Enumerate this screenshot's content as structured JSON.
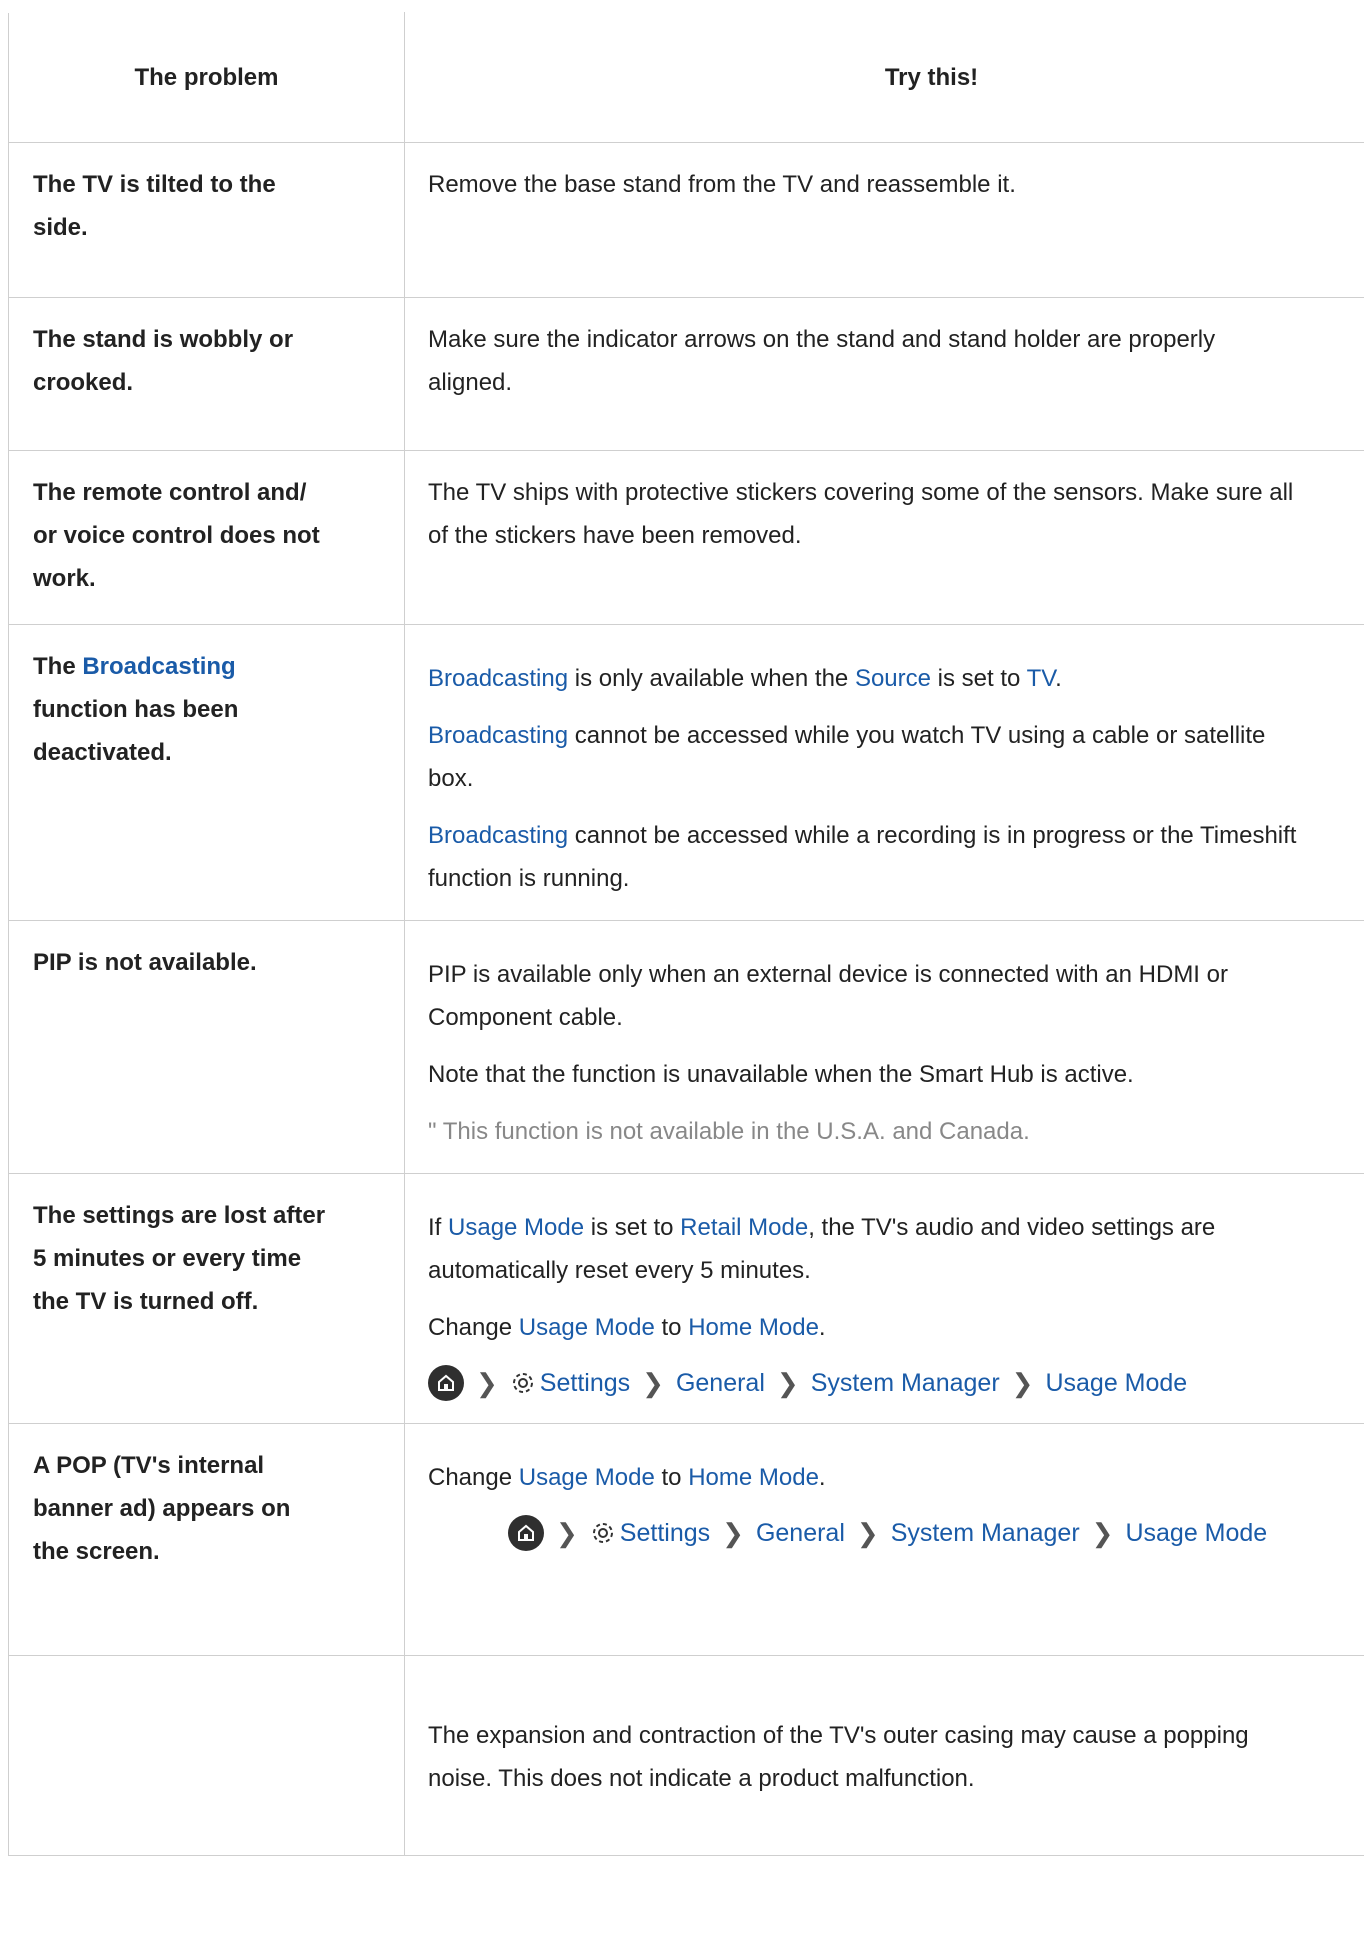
{
  "header": {
    "col1": "The problem",
    "col2": "Try this!"
  },
  "rows": [
    {
      "problem": "The TV is tilted to the side.",
      "problem_lines": [
        "The TV is tilted to the",
        "side."
      ],
      "solution_lines": [
        "Remove the base stand from the TV and reassemble it."
      ]
    },
    {
      "problem_lines": [
        "The stand is wobbly or",
        "crooked."
      ],
      "solution_lines": [
        "Make sure the indicator arrows on the stand and stand holder are properly",
        "aligned."
      ]
    },
    {
      "problem_lines": [
        "The remote control and/",
        "or voice control does not",
        "work."
      ],
      "solution_lines": [
        "The TV ships with protective stickers covering some of the sensors. Make sure all",
        "of the stickers have been removed."
      ]
    },
    {
      "problem_prefix": "The ",
      "problem_link": "Broadcasting",
      "problem_lines": [
        "function has been",
        "deactivated."
      ],
      "p1": {
        "link1": "Broadcasting",
        "text1": " is only available when the ",
        "link2": "Source",
        "text2": " is set to ",
        "link3": "TV",
        "text3": "."
      },
      "p2": {
        "link": "Broadcasting",
        "text": " cannot be accessed while you watch TV using a cable or satellite",
        "line2": "box."
      },
      "p3": {
        "link": "Broadcasting",
        "text": " cannot be accessed while a recording is in progress or the Timeshift",
        "line2": "function is running."
      }
    },
    {
      "problem_lines": [
        "PIP is not available."
      ],
      "p1_lines": [
        "PIP is available only when an external device is connected with an HDMI or",
        "Component cable."
      ],
      "p2": "Note that the function is unavailable when the Smart Hub is active.",
      "note": "\" This function is not available in the U.S.A. and Canada."
    },
    {
      "problem_lines": [
        "The settings are lost after",
        "5 minutes or every time",
        "the TV is turned off."
      ],
      "p1": {
        "text1": "If ",
        "link1": "Usage Mode",
        "text2": " is set to ",
        "link2": "Retail Mode",
        "text3": ", the TV's audio and video settings are",
        "line2": "automatically reset every 5 minutes."
      },
      "p2": {
        "text1": "Change ",
        "link1": "Usage Mode",
        "text2": " to ",
        "link2": "Home Mode",
        "text3": "."
      },
      "menu": [
        "Settings",
        "General",
        "System Manager",
        "Usage Mode"
      ]
    },
    {
      "problem_lines": [
        "A POP (TV's internal",
        "banner ad) appears on",
        "the screen."
      ],
      "p1": {
        "text1": "Change ",
        "link1": "Usage Mode",
        "text2": " to ",
        "link2": "Home Mode",
        "text3": "."
      },
      "menu": [
        "Settings",
        "General",
        "System Manager",
        "Usage Mode"
      ]
    },
    {
      "problem_lines": [],
      "solution_lines": [
        "The expansion and contraction of the TV's outer casing may cause a popping",
        "noise. This does not indicate a product malfunction."
      ]
    }
  ],
  "icons": {
    "home": "home-icon",
    "settings": "gear-icon",
    "separator": "chevron-right-icon"
  },
  "colors": {
    "link": "#1a5ba8",
    "note": "#888888",
    "border": "#cfcfcf"
  }
}
